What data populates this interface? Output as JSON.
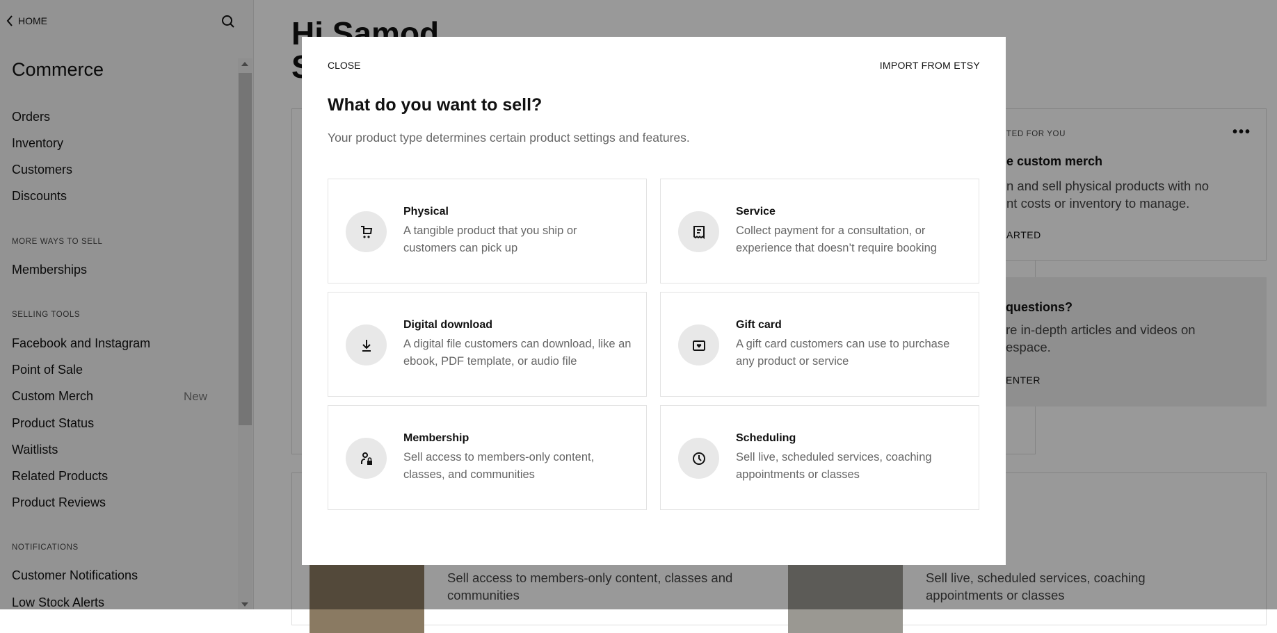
{
  "sidebar": {
    "back_label": "HOME",
    "title": "Commerce",
    "items": [
      "Orders",
      "Inventory",
      "Customers",
      "Discounts"
    ],
    "more_ways_heading": "MORE WAYS TO SELL",
    "more_ways_items": [
      "Memberships"
    ],
    "selling_tools_heading": "SELLING TOOLS",
    "selling_tools_items": [
      "Facebook and Instagram",
      "Point of Sale",
      "Custom Merch",
      "Product Status",
      "Waitlists",
      "Related Products",
      "Product Reviews"
    ],
    "custom_merch_badge": "New",
    "notifications_heading": "NOTIFICATIONS",
    "notifications_items": [
      "Customer Notifications",
      "Low Stock Alerts"
    ]
  },
  "main": {
    "greeting_line1": "Hi Samod",
    "greeting_line2": "S",
    "suggested": {
      "eyebrow": "TED FOR YOU",
      "title": "e custom merch",
      "desc_line1": "n and sell physical products with no",
      "desc_line2": "nt costs or inventory to manage.",
      "cta": "ARTED"
    },
    "help": {
      "title": "questions?",
      "desc_line1": "re in-depth articles and videos on",
      "desc_line2": "espace.",
      "cta": "ENTER"
    },
    "bottom": {
      "membership_desc": "Sell access to members-only content, classes and communities",
      "scheduling_desc": "Sell live, scheduled services, coaching appointments or classes"
    }
  },
  "modal": {
    "close_label": "CLOSE",
    "import_label": "IMPORT FROM ETSY",
    "title": "What do you want to sell?",
    "subtitle": "Your product type determines certain product settings and features.",
    "types": [
      {
        "title": "Physical",
        "desc": "A tangible product that you ship or customers can pick up",
        "icon": "cart-icon"
      },
      {
        "title": "Service",
        "desc": "Collect payment for a consultation, or experience that doesn’t require booking",
        "icon": "receipt-icon"
      },
      {
        "title": "Digital download",
        "desc": "A digital file customers can download, like an ebook, PDF template, or audio file",
        "icon": "download-icon"
      },
      {
        "title": "Gift card",
        "desc": "A gift card customers can use to purchase any product or service",
        "icon": "gift-card-icon"
      },
      {
        "title": "Membership",
        "desc": "Sell access to members-only content, classes, and communities",
        "icon": "member-lock-icon"
      },
      {
        "title": "Scheduling",
        "desc": "Sell live, scheduled services, coaching appointments or classes",
        "icon": "clock-icon"
      }
    ]
  }
}
